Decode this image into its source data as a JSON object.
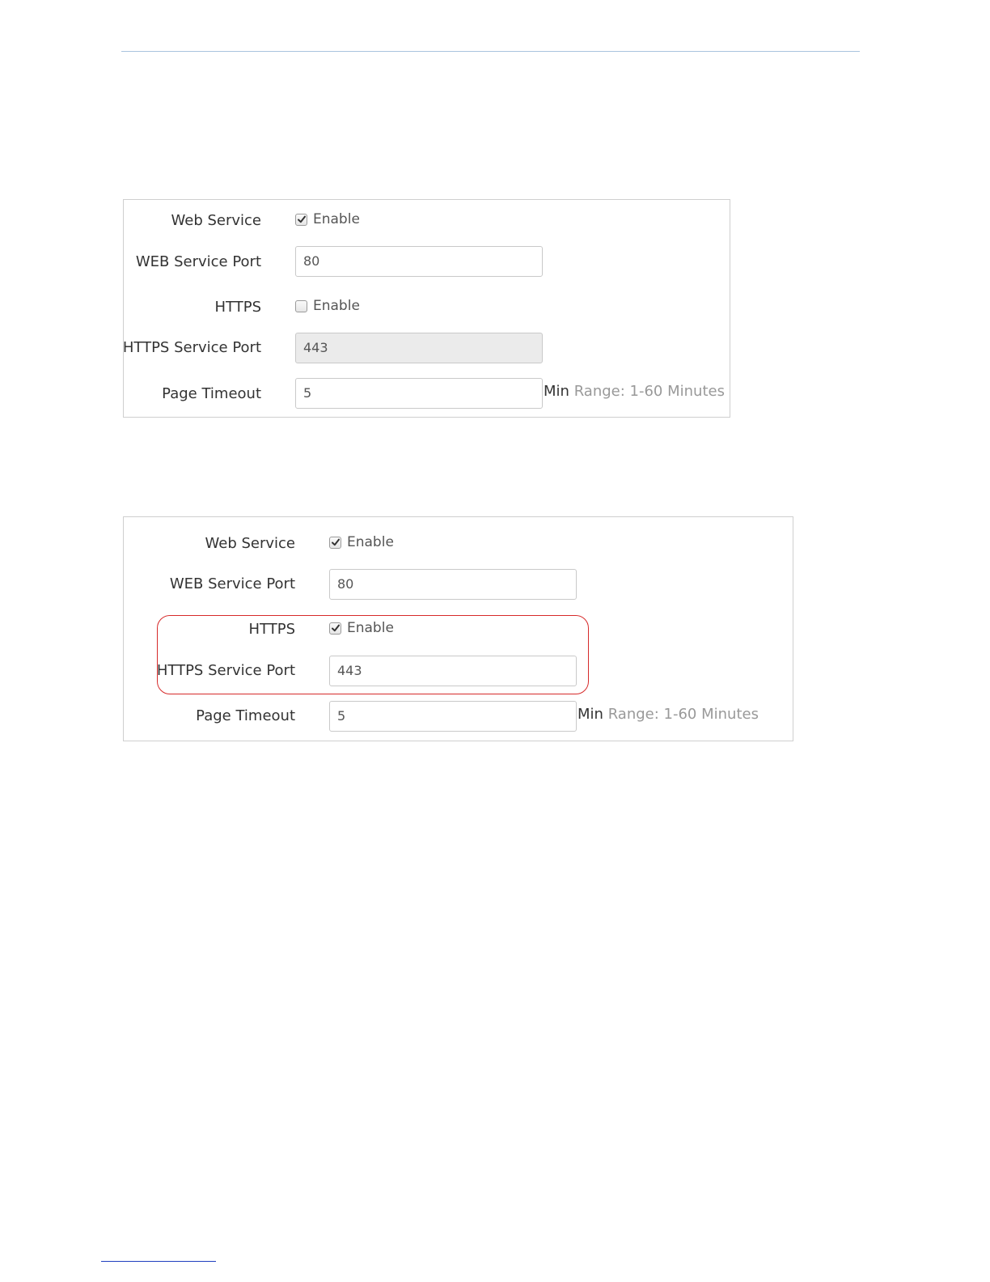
{
  "panel_before": {
    "web_service_label": "Web Service",
    "web_service_enable": "Enable",
    "web_service_checked": true,
    "web_port_label": "WEB Service Port",
    "web_port_value": "80",
    "https_label": "HTTPS",
    "https_enable": "Enable",
    "https_checked": false,
    "https_port_label": "HTTPS Service Port",
    "https_port_value": "443",
    "https_port_disabled": true,
    "timeout_label": "Page Timeout",
    "timeout_value": "5",
    "timeout_unit": "Min",
    "timeout_hint": "Range: 1-60 Minutes"
  },
  "panel_after": {
    "web_service_label": "Web Service",
    "web_service_enable": "Enable",
    "web_service_checked": true,
    "web_port_label": "WEB Service Port",
    "web_port_value": "80",
    "https_label": "HTTPS",
    "https_enable": "Enable",
    "https_checked": true,
    "https_port_label": "HTTPS Service Port",
    "https_port_value": "443",
    "https_port_disabled": false,
    "timeout_label": "Page Timeout",
    "timeout_value": "5",
    "timeout_unit": "Min",
    "timeout_hint": "Range: 1-60 Minutes"
  },
  "colors": {
    "header_rule": "#a9c4de",
    "highlight_border": "#d62a2a",
    "hint_text": "#999999"
  }
}
